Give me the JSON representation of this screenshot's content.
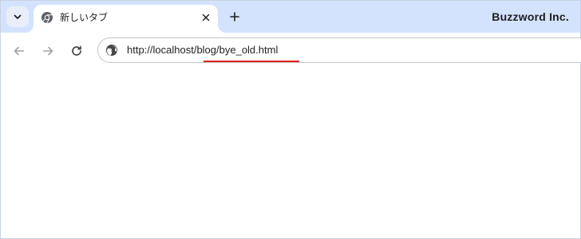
{
  "tabstrip": {
    "tab": {
      "title": "新しいタブ"
    },
    "brand": "Buzzword Inc.",
    "icons": [
      "chevron-down-icon",
      "chrome-favicon-icon",
      "close-icon",
      "plus-icon"
    ]
  },
  "toolbar": {
    "url": "http://localhost/blog/bye_old.html",
    "icons": [
      "back-arrow-icon",
      "forward-arrow-icon",
      "reload-icon",
      "globe-icon"
    ]
  },
  "colors": {
    "tabstrip_bg": "#d3e3fd",
    "annotation_underline": "#dd2222"
  }
}
